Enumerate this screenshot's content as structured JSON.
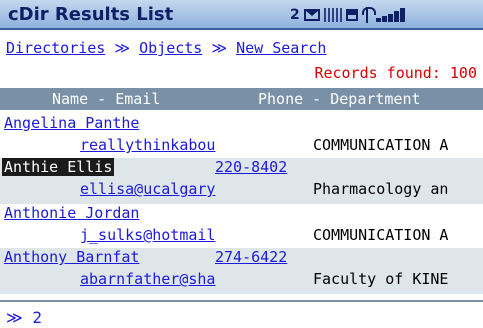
{
  "app": {
    "title": "cDir Results List",
    "status_number": "2"
  },
  "nav": {
    "directories": "Directories",
    "objects": "Objects",
    "new_search": "New Search",
    "separator": "≫"
  },
  "records": {
    "text": "Records found: 100"
  },
  "table": {
    "headers": [
      "Name - Email",
      "Phone - Department"
    ],
    "rows": [
      {
        "name": "Angelina Panthe",
        "phone": "",
        "email": "reallythinkabou",
        "dept": "COMMUNICATION A"
      },
      {
        "name": "Anthie Ellis",
        "phone": "220-8402",
        "email": "ellisa@ucalgary",
        "dept": "Pharmacology an"
      },
      {
        "name": "Anthonie Jordan",
        "phone": "",
        "email": "j_sulks@hotmail",
        "dept": "COMMUNICATION A"
      },
      {
        "name": "Anthony Barnfat",
        "phone": "274-6422",
        "email": "abarnfather@sha",
        "dept": "Faculty of KINE"
      }
    ]
  },
  "footer": {
    "more": "≫ 2"
  },
  "colors": {
    "title_text": "#0f1f66",
    "link": "#1b1bd9",
    "records": "#d90000",
    "header_bg": "#7990a6",
    "alt_row_bg": "#dfe6ea"
  }
}
